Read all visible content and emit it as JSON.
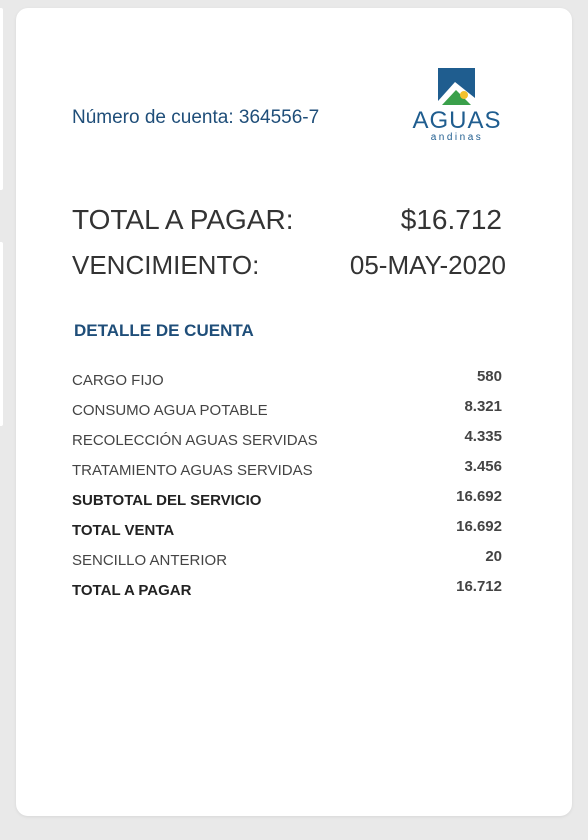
{
  "account": {
    "label": "Número de cuenta:",
    "number": "364556-7"
  },
  "logo": {
    "word": "AGUAS",
    "sub": "andinas",
    "icon": "mountain-sun-icon",
    "colors": {
      "blue": "#1f5d8f",
      "green": "#3aa04a",
      "yellow": "#f2c12e"
    }
  },
  "summary": {
    "total_label": "TOTAL A PAGAR:",
    "total_value": "$16.712",
    "due_label": "VENCIMIENTO:",
    "due_value": "05-MAY-2020"
  },
  "detail": {
    "title": "DETALLE DE CUENTA",
    "rows": [
      {
        "label": "CARGO FIJO",
        "value": "580",
        "bold": false
      },
      {
        "label": "CONSUMO AGUA POTABLE",
        "value": "8.321",
        "bold": false
      },
      {
        "label": "RECOLECCIÓN AGUAS SERVIDAS",
        "value": "4.335",
        "bold": false
      },
      {
        "label": "TRATAMIENTO AGUAS SERVIDAS",
        "value": "3.456",
        "bold": false
      },
      {
        "label": "SUBTOTAL DEL SERVICIO",
        "value": "16.692",
        "bold": true
      },
      {
        "label": "TOTAL VENTA",
        "value": "16.692",
        "bold": true
      },
      {
        "label": "SENCILLO ANTERIOR",
        "value": "20",
        "bold": false
      },
      {
        "label": "TOTAL A PAGAR",
        "value": "16.712",
        "bold": true
      }
    ]
  },
  "colors": {
    "accent": "#1f4e79",
    "background": "#e9e9e9",
    "card": "#ffffff",
    "text": "#333333"
  }
}
